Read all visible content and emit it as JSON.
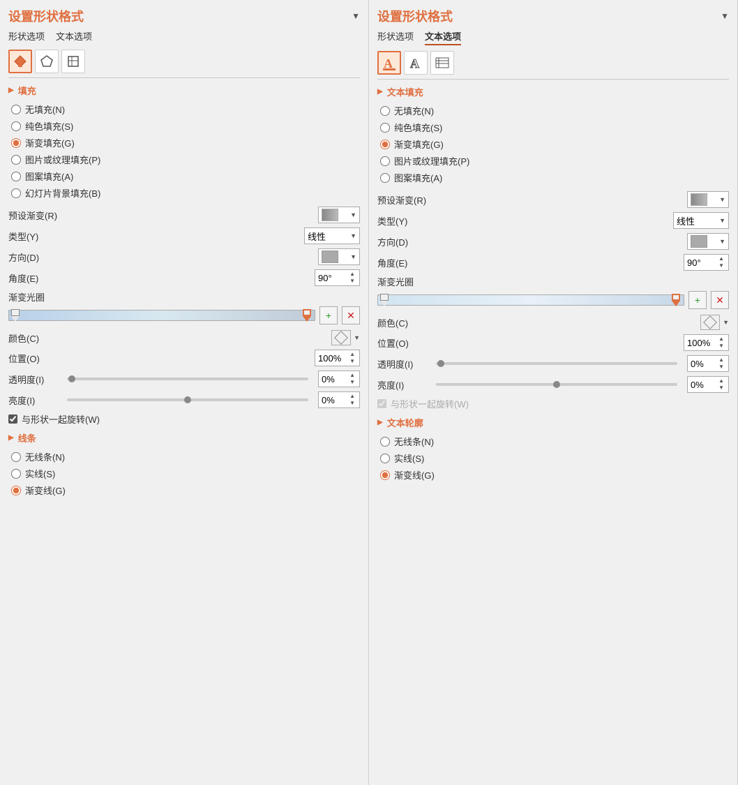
{
  "left": {
    "title": "设置形状格式",
    "tabs": [
      {
        "label": "形状选项",
        "active": false
      },
      {
        "label": "文本选项",
        "active": false
      }
    ],
    "icons": [
      "fill-icon",
      "shape-icon",
      "layout-icon"
    ],
    "sections": {
      "fill": {
        "header": "填充",
        "options": [
          {
            "label": "无填充(N)",
            "checked": false
          },
          {
            "label": "纯色填充(S)",
            "checked": false
          },
          {
            "label": "渐变填充(G)",
            "checked": true
          },
          {
            "label": "图片或纹理填充(P)",
            "checked": false
          },
          {
            "label": "图案填充(A)",
            "checked": false
          },
          {
            "label": "幻灯片背景填充(B)",
            "checked": false
          }
        ],
        "preset_label": "预设渐变(R)",
        "type_label": "类型(Y)",
        "type_value": "线性",
        "direction_label": "方向(D)",
        "angle_label": "角度(E)",
        "angle_value": "90°",
        "gradient_label": "渐变光圈",
        "color_label": "颜色(C)",
        "position_label": "位置(O)",
        "position_value": "100%",
        "transparency_label": "透明度(I)",
        "transparency_value": "0%",
        "brightness_label": "亮度(I)",
        "brightness_value": "0%",
        "rotate_label": "与形状一起旋转(W)",
        "rotate_checked": true
      },
      "line": {
        "header": "线条",
        "options": [
          {
            "label": "无线条(N)",
            "checked": false
          },
          {
            "label": "实线(S)",
            "checked": false
          },
          {
            "label": "渐变线(G)",
            "checked": true
          }
        ]
      }
    }
  },
  "right": {
    "title": "设置形状格式",
    "tabs": [
      {
        "label": "形状选项",
        "active": false
      },
      {
        "label": "文本选项",
        "active": true
      }
    ],
    "icons": [
      "text-fill-icon",
      "text-outline-icon",
      "text-effects-icon"
    ],
    "sections": {
      "fill": {
        "header": "文本填充",
        "options": [
          {
            "label": "无填充(N)",
            "checked": false
          },
          {
            "label": "纯色填充(S)",
            "checked": false
          },
          {
            "label": "渐变填充(G)",
            "checked": true
          },
          {
            "label": "图片或纹理填充(P)",
            "checked": false
          },
          {
            "label": "图案填充(A)",
            "checked": false
          }
        ],
        "preset_label": "预设渐变(R)",
        "type_label": "类型(Y)",
        "type_value": "线性",
        "direction_label": "方向(D)",
        "angle_label": "角度(E)",
        "angle_value": "90°",
        "gradient_label": "渐变光圈",
        "color_label": "颜色(C)",
        "position_label": "位置(O)",
        "position_value": "100%",
        "transparency_label": "透明度(I)",
        "transparency_value": "0%",
        "brightness_label": "亮度(I)",
        "brightness_value": "0%",
        "rotate_label": "与形状一起旋转(W)",
        "rotate_checked": true,
        "rotate_disabled": true
      },
      "line": {
        "header": "文本轮廓",
        "options": [
          {
            "label": "无线条(N)",
            "checked": false
          },
          {
            "label": "实线(S)",
            "checked": false
          },
          {
            "label": "渐变线(G)",
            "checked": true
          }
        ]
      }
    }
  }
}
